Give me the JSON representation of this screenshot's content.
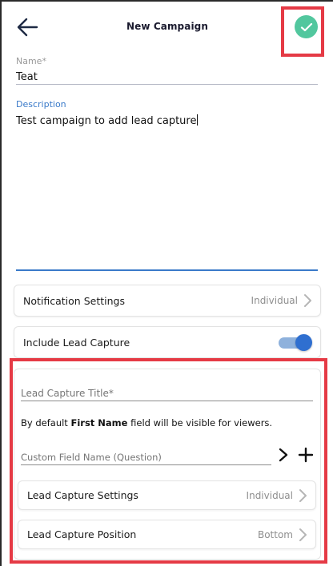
{
  "header": {
    "title": "New Campaign"
  },
  "form": {
    "name_label": "Name*",
    "name_value": "Teat",
    "description_label": "Description",
    "description_value": "Test campaign to add lead capture"
  },
  "notification_settings": {
    "label": "Notification Settings",
    "value": "Individual"
  },
  "include_lead_capture": {
    "label": "Include Lead Capture",
    "enabled": true
  },
  "lead_capture": {
    "title_placeholder": "Lead Capture Title*",
    "note_prefix": "By default",
    "note_field": "First Name",
    "note_suffix": "field will be visible for viewers.",
    "custom_field_placeholder": "Custom Field Name (Question)",
    "settings_label": "Lead Capture Settings",
    "settings_value": "Individual",
    "position_label": "Lead Capture Position",
    "position_value": "Bottom"
  },
  "icons": {
    "back": "arrow-left-icon",
    "done": "check-icon",
    "chevron": "chevron-right-icon",
    "next": "chevron-right-icon",
    "add": "plus-icon"
  },
  "colors": {
    "done_button": "#52c79e",
    "accent_blue": "#3a7ac9",
    "toggle_track": "#8eb1dc",
    "toggle_knob": "#2f6fd0",
    "highlight_red": "#e53a45",
    "secondary_text": "#8e8e8e"
  }
}
